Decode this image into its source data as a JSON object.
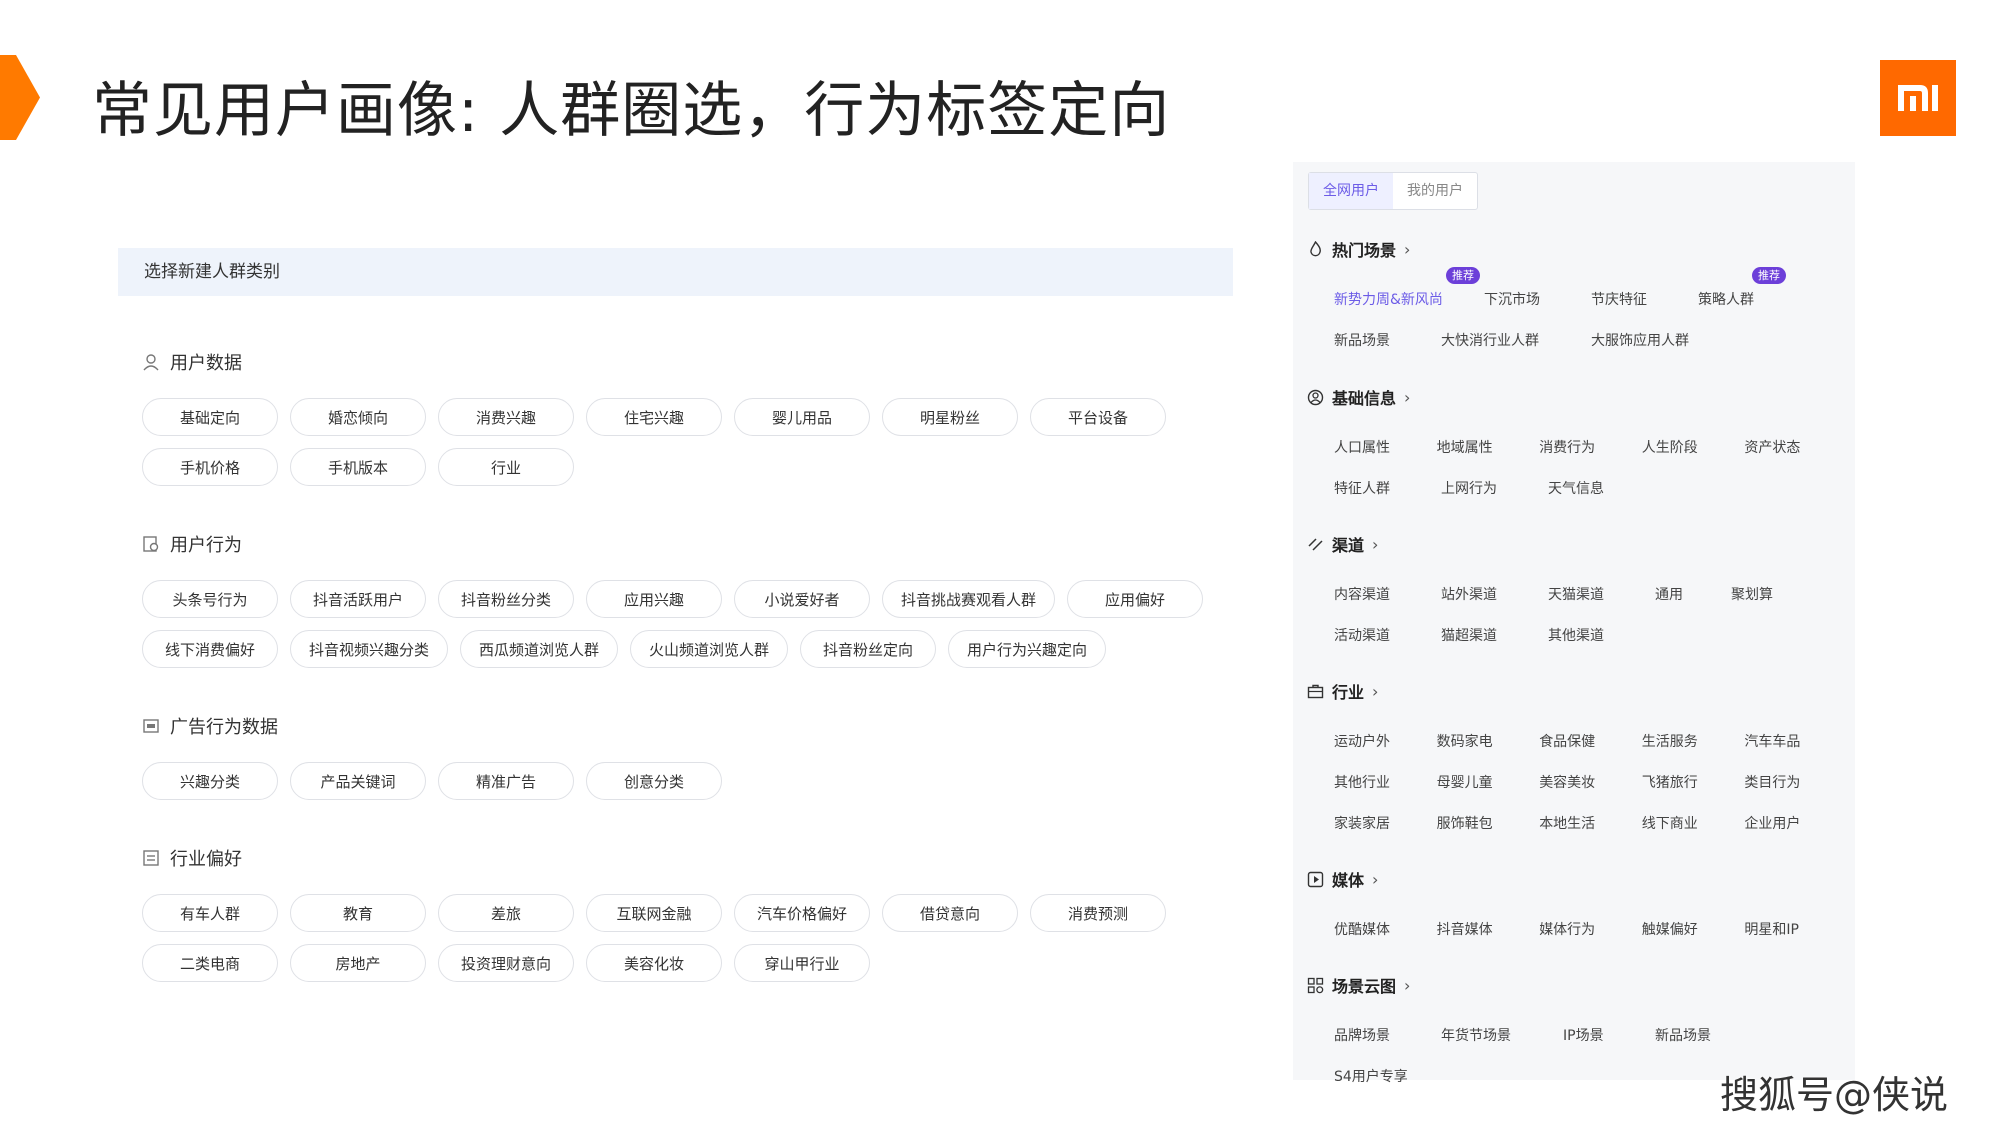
{
  "slide": {
    "title": "常见用户画像: 人群圈选，行为标签定向",
    "brand_color": "#ff6900",
    "logo": "mi-logo",
    "caption": "搜狐号@侠说"
  },
  "left_panel": {
    "header": "选择新建人群类别",
    "sections": [
      {
        "title": "用户数据",
        "icon": "user-data-icon",
        "rows": [
          [
            "基础定向",
            "婚恋倾向",
            "消费兴趣",
            "住宅兴趣",
            "婴儿用品",
            "明星粉丝",
            "平台设备"
          ],
          [
            "手机价格",
            "手机版本",
            "行业"
          ]
        ]
      },
      {
        "title": "用户行为",
        "icon": "user-behavior-icon",
        "rows": [
          [
            "头条号行为",
            "抖音活跃用户",
            "抖音粉丝分类",
            "应用兴趣",
            "小说爱好者",
            "抖音挑战赛观看人群",
            "应用偏好"
          ],
          [
            "线下消费偏好",
            "抖音视频兴趣分类",
            "西瓜频道浏览人群",
            "火山频道浏览人群",
            "抖音粉丝定向",
            "用户行为兴趣定向"
          ]
        ]
      },
      {
        "title": "广告行为数据",
        "icon": "ad-behavior-icon",
        "rows": [
          [
            "兴趣分类",
            "产品关键词",
            "精准广告",
            "创意分类"
          ]
        ]
      },
      {
        "title": "行业偏好",
        "icon": "industry-pref-icon",
        "rows": [
          [
            "有车人群",
            "教育",
            "差旅",
            "互联网金融",
            "汽车价格偏好",
            "借贷意向",
            "消费预测"
          ],
          [
            "二类电商",
            "房地产",
            "投资理财意向",
            "美容化妆",
            "穿山甲行业"
          ]
        ]
      }
    ]
  },
  "right_panel": {
    "tabs": [
      {
        "label": "全网用户",
        "active": true
      },
      {
        "label": "我的用户",
        "active": false
      }
    ],
    "accent_color": "#6c5ce7",
    "sections": [
      {
        "title": "热门场景",
        "icon": "flame-icon",
        "rows": [
          [
            {
              "label": "新势力周&新风尚",
              "highlight": true,
              "badge": "推荐"
            },
            {
              "label": "下沉市场"
            },
            {
              "label": "节庆特征"
            },
            {
              "label": "策略人群",
              "badge": "推荐"
            }
          ],
          [
            {
              "label": "新品场景"
            },
            {
              "label": "大快消行业人群"
            },
            {
              "label": "大服饰应用人群"
            }
          ]
        ]
      },
      {
        "title": "基础信息",
        "icon": "user-circle-icon",
        "rows": [
          [
            {
              "label": "人口属性"
            },
            {
              "label": "地域属性"
            },
            {
              "label": "消费行为"
            },
            {
              "label": "人生阶段"
            },
            {
              "label": "资产状态"
            }
          ],
          [
            {
              "label": "特征人群"
            },
            {
              "label": "上网行为"
            },
            {
              "label": "天气信息"
            }
          ]
        ]
      },
      {
        "title": "渠道",
        "icon": "channel-icon",
        "rows": [
          [
            {
              "label": "内容渠道"
            },
            {
              "label": "站外渠道"
            },
            {
              "label": "天猫渠道"
            },
            {
              "label": "通用"
            },
            {
              "label": "聚划算"
            }
          ],
          [
            {
              "label": "活动渠道"
            },
            {
              "label": "猫超渠道"
            },
            {
              "label": "其他渠道"
            }
          ]
        ]
      },
      {
        "title": "行业",
        "icon": "briefcase-icon",
        "rows": [
          [
            {
              "label": "运动户外"
            },
            {
              "label": "数码家电"
            },
            {
              "label": "食品保健"
            },
            {
              "label": "生活服务"
            },
            {
              "label": "汽车车品"
            }
          ],
          [
            {
              "label": "其他行业"
            },
            {
              "label": "母婴儿童"
            },
            {
              "label": "美容美妆"
            },
            {
              "label": "飞猪旅行"
            },
            {
              "label": "类目行为"
            }
          ],
          [
            {
              "label": "家装家居"
            },
            {
              "label": "服饰鞋包"
            },
            {
              "label": "本地生活"
            },
            {
              "label": "线下商业"
            },
            {
              "label": "企业用户"
            }
          ]
        ]
      },
      {
        "title": "媒体",
        "icon": "play-icon",
        "rows": [
          [
            {
              "label": "优酷媒体"
            },
            {
              "label": "抖音媒体"
            },
            {
              "label": "媒体行为"
            },
            {
              "label": "触媒偏好"
            },
            {
              "label": "明星和IP"
            }
          ]
        ]
      },
      {
        "title": "场景云图",
        "icon": "grid-icon",
        "rows": [
          [
            {
              "label": "品牌场景"
            },
            {
              "label": "年货节场景"
            },
            {
              "label": "IP场景"
            },
            {
              "label": "新品场景"
            }
          ],
          [
            {
              "label": "S4用户专享"
            }
          ]
        ]
      }
    ]
  }
}
